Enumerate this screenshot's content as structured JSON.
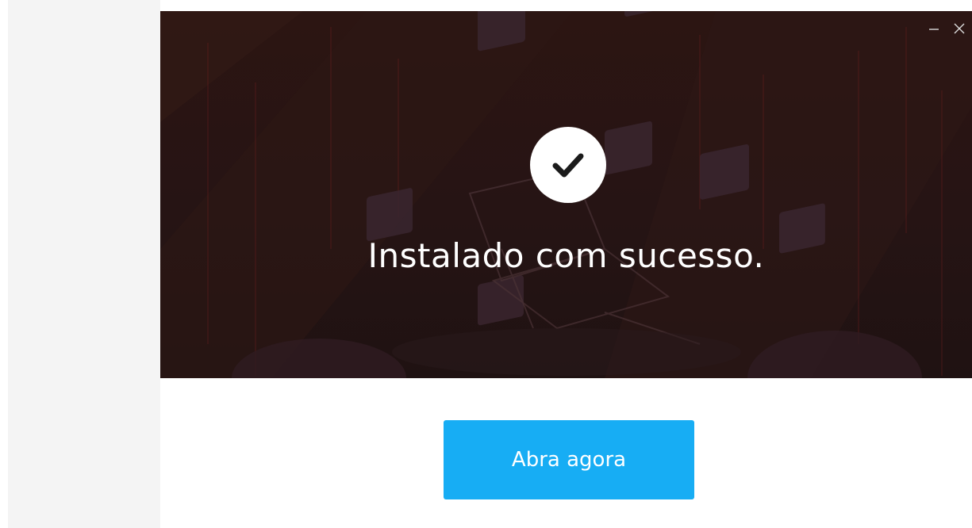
{
  "window": {
    "controls": {
      "minimize_icon": "minimize-icon",
      "close_icon": "close-icon"
    }
  },
  "hero": {
    "status_icon": "checkmark-icon",
    "message": "Instalado com sucesso."
  },
  "actions": {
    "open_label": "Abra agora"
  },
  "colors": {
    "accent": "#17adf4",
    "hero_background": "#2a1513",
    "sidebar_background": "#f4f4f4"
  }
}
